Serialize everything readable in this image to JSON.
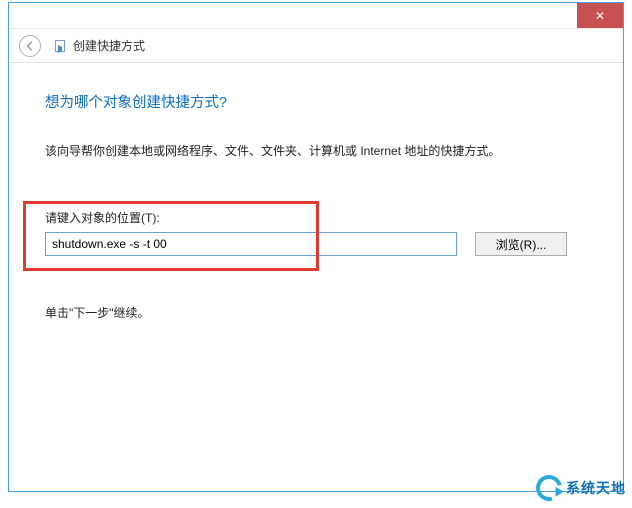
{
  "window": {
    "close_label": "✕"
  },
  "header": {
    "wizard_title": "创建快捷方式"
  },
  "content": {
    "heading": "想为哪个对象创建快捷方式?",
    "description": "该向导帮你创建本地或网络程序、文件、文件夹、计算机或 Internet 地址的快捷方式。",
    "location_label": "请键入对象的位置(T):",
    "location_value": "shutdown.exe -s -t 00",
    "browse_label": "浏览(R)...",
    "continue_hint": "单击\"下一步\"继续。"
  },
  "watermark": {
    "text": "系统天地"
  }
}
